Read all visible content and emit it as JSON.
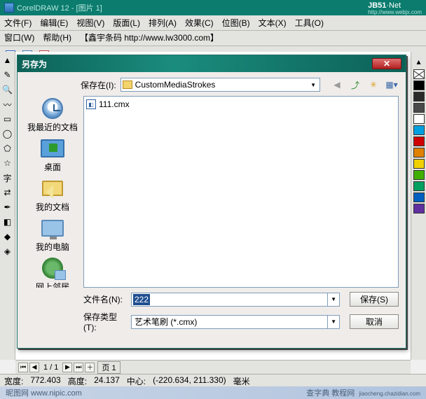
{
  "app": {
    "title": "CorelDRAW 12 - [图片 1]",
    "watermark_brand": "JB51",
    "watermark_sub": "Net",
    "watermark_url": "http://www.webjx.com"
  },
  "menu": [
    {
      "label": "文件(F)"
    },
    {
      "label": "编辑(E)"
    },
    {
      "label": "视图(V)"
    },
    {
      "label": "版面(L)"
    },
    {
      "label": "排列(A)"
    },
    {
      "label": "效果(C)"
    },
    {
      "label": "位图(B)"
    },
    {
      "label": "文本(X)"
    },
    {
      "label": "工具(O)"
    }
  ],
  "menu2": {
    "window": "窗口(W)",
    "help": "帮助(H)",
    "url_text": "【鑫宇条码 http://www.lw3000.com】"
  },
  "palette": [
    "#000000",
    "#2a2a2a",
    "#4a4a4a",
    "#ffffff",
    "#00a0e0",
    "#d00000",
    "#e08000",
    "#f0d000",
    "#40b000",
    "#00a060",
    "#0060c0",
    "#6030a0"
  ],
  "dlg": {
    "title": "另存为",
    "save_in_label": "保存在(I):",
    "folder_name": "CustomMediaStrokes",
    "places": [
      {
        "label": "我最近的文档",
        "icon": "recent"
      },
      {
        "label": "桌面",
        "icon": "desktop"
      },
      {
        "label": "我的文档",
        "icon": "docs"
      },
      {
        "label": "我的电脑",
        "icon": "pc"
      },
      {
        "label": "网上邻居",
        "icon": "net"
      }
    ],
    "files": [
      {
        "name": "111.cmx"
      }
    ],
    "filename_label": "文件名(N):",
    "filename_value": "222",
    "filetype_label": "保存类型(T):",
    "filetype_value": "艺术笔刷 (*.cmx)",
    "btn_save": "保存(S)",
    "btn_cancel": "取消"
  },
  "pagenav": {
    "page": "1 / 1",
    "tab": "页 1"
  },
  "status": {
    "width_label": "宽度:",
    "width_val": "772.403",
    "height_label": "高度:",
    "height_val": "24.137",
    "center_label": "中心:",
    "center_val": "(-220.634, 211.330)",
    "unit": "毫米"
  },
  "footer": {
    "left": "昵图网 www.nipic.com",
    "right": "查字典   教程网",
    "url": "jiaocheng.chazidian.com"
  }
}
